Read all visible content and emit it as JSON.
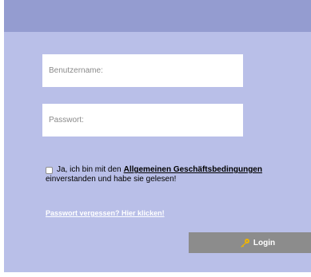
{
  "login_form": {
    "username": {
      "value": "",
      "placeholder": "Benutzername:"
    },
    "password": {
      "value": "",
      "placeholder": "Passwort:"
    },
    "terms": {
      "checked": false,
      "text_before": "Ja, ich bin mit den",
      "link_label": "Allgemeinen Geschäftsbedingungen",
      "text_after": "einverstanden und habe sie gelesen!"
    },
    "forgot_password_label": "Passwort vergessen? Hier klicken!",
    "login_button": {
      "label": "Login",
      "icon": "key-icon"
    }
  },
  "colors": {
    "panel_background": "#b9bfe8",
    "header_bar": "#949cd0",
    "button_background": "#8c8c8c",
    "key_icon": "#f0b400"
  }
}
